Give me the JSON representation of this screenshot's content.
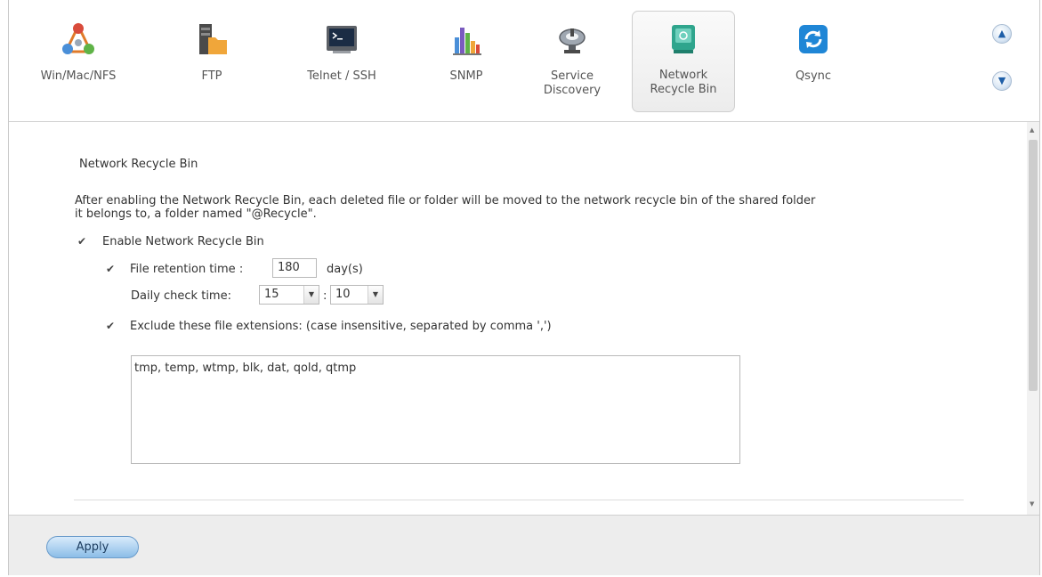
{
  "toolbar": {
    "items": [
      {
        "label": "Win/Mac/NFS",
        "icon": "network-shares-icon"
      },
      {
        "label": "FTP",
        "icon": "ftp-server-icon"
      },
      {
        "label": "Telnet / SSH",
        "icon": "terminal-icon"
      },
      {
        "label": "SNMP",
        "icon": "bar-chart-icon"
      },
      {
        "label": "Service\nDiscovery",
        "icon": "satellite-dish-icon"
      },
      {
        "label": "Network\nRecycle Bin",
        "icon": "recycle-bin-icon"
      },
      {
        "label": "Qsync",
        "icon": "sync-icon"
      }
    ],
    "active": "Network Recycle Bin",
    "up_icon": "chevron-up-icon",
    "down_icon": "chevron-down-icon"
  },
  "section": {
    "title": "Network Recycle Bin",
    "description_line1": "After enabling the Network Recycle Bin, each deleted file or folder will be moved to the network recycle bin of the shared folder",
    "description_line2": "it belongs to, a folder named \"@Recycle\"."
  },
  "settings": {
    "enable_label": "Enable Network Recycle Bin",
    "enable_checked": true,
    "retention_label": "File retention time :",
    "retention_checked": true,
    "retention_value": "180",
    "retention_unit": "day(s)",
    "daily_check_label": "Daily check time:",
    "hour_value": "15",
    "time_separator": ":",
    "minute_value": "10",
    "exclude_label": "Exclude these file extensions: (case insensitive, separated by comma ',')",
    "exclude_checked": true,
    "exclude_value": "tmp, temp, wtmp, blk, dat, qold, qtmp"
  },
  "footer": {
    "apply_label": "Apply"
  },
  "colors": {
    "accent": "#1f5fa8",
    "button_gradient_top": "#d9ebfb",
    "button_gradient_bottom": "#8bbde7"
  }
}
